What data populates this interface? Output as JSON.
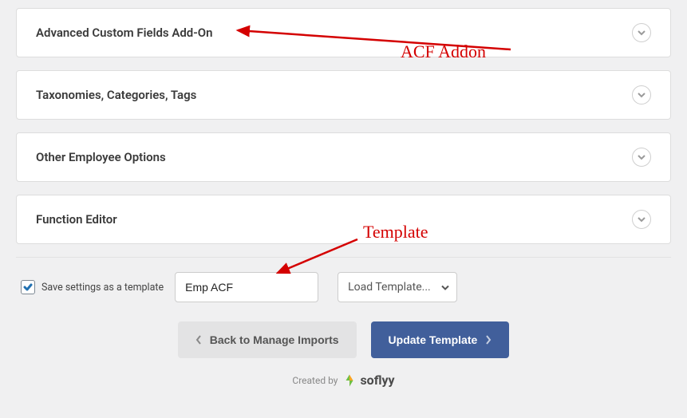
{
  "panels": {
    "acf": "Advanced Custom Fields Add-On",
    "tax": "Taxonomies, Categories, Tags",
    "other": "Other Employee Options",
    "func": "Function Editor"
  },
  "template": {
    "save_label": "Save settings as a template",
    "name_value": "Emp ACF",
    "load_label": "Load Template..."
  },
  "buttons": {
    "back": "Back to Manage Imports",
    "update": "Update Template"
  },
  "footer": {
    "created": "Created by",
    "brand": "soflyy"
  },
  "annotations": {
    "acf": "ACF Addon",
    "template": "Template"
  }
}
